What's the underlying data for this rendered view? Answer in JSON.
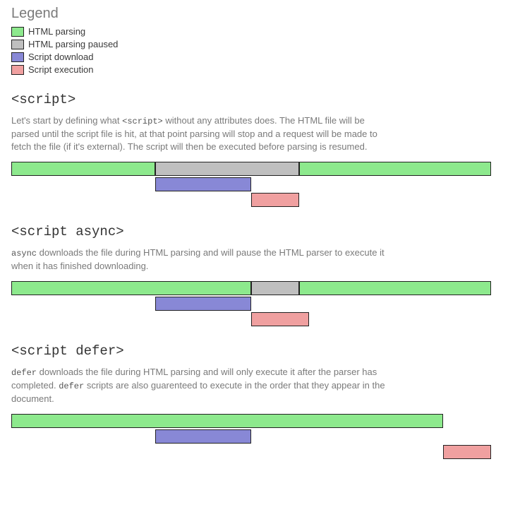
{
  "colors": {
    "html_parsing": "#8de98d",
    "parsing_paused": "#bfbfbf",
    "download": "#8888d6",
    "execution": "#f0a0a0"
  },
  "legend": {
    "title": "Legend",
    "items": [
      {
        "label": "HTML parsing",
        "color_key": "html_parsing"
      },
      {
        "label": "HTML parsing paused",
        "color_key": "parsing_paused"
      },
      {
        "label": "Script download",
        "color_key": "download"
      },
      {
        "label": "Script execution",
        "color_key": "execution"
      }
    ]
  },
  "sections": [
    {
      "heading_code": "<script>",
      "description_parts": [
        "Let's start by defining what ",
        {
          "code": "<script>"
        },
        " without any attributes does. The HTML file will be parsed until the script file is hit, at that point parsing will stop and a request will be made to fetch the file (if it's external). The script will then be executed before parsing is resumed."
      ],
      "bars": [
        {
          "lane": 0,
          "kind": "html_parsing",
          "start": 0,
          "end": 30
        },
        {
          "lane": 0,
          "kind": "parsing_paused",
          "start": 30,
          "end": 60
        },
        {
          "lane": 0,
          "kind": "html_parsing",
          "start": 60,
          "end": 100
        },
        {
          "lane": 1,
          "kind": "download",
          "start": 30,
          "end": 50
        },
        {
          "lane": 2,
          "kind": "execution",
          "start": 50,
          "end": 60
        }
      ]
    },
    {
      "heading_code": "<script async>",
      "description_parts": [
        {
          "code": "async"
        },
        " downloads the file during HTML parsing and will pause the HTML parser to execute it when it has finished downloading."
      ],
      "bars": [
        {
          "lane": 0,
          "kind": "html_parsing",
          "start": 0,
          "end": 50
        },
        {
          "lane": 0,
          "kind": "parsing_paused",
          "start": 50,
          "end": 60
        },
        {
          "lane": 0,
          "kind": "html_parsing",
          "start": 60,
          "end": 100
        },
        {
          "lane": 1,
          "kind": "download",
          "start": 30,
          "end": 50
        },
        {
          "lane": 2,
          "kind": "execution",
          "start": 50,
          "end": 62
        }
      ]
    },
    {
      "heading_code": "<script defer>",
      "description_parts": [
        {
          "code": "defer"
        },
        " downloads the file during HTML parsing and will only execute it after the parser has completed. ",
        {
          "code": "defer"
        },
        " scripts are also guarenteed to execute in the order that they appear in the document."
      ],
      "bars": [
        {
          "lane": 0,
          "kind": "html_parsing",
          "start": 0,
          "end": 90
        },
        {
          "lane": 1,
          "kind": "download",
          "start": 30,
          "end": 50
        },
        {
          "lane": 2,
          "kind": "execution",
          "start": 90,
          "end": 100
        }
      ]
    }
  ]
}
